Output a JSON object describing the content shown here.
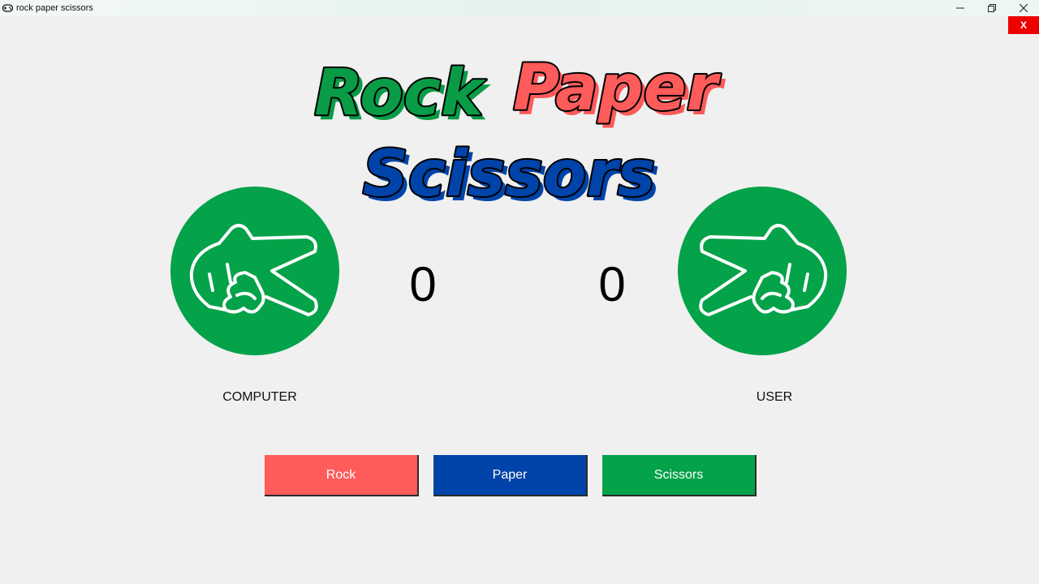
{
  "window": {
    "title": "rock paper scissors",
    "icon": "gamepad-icon",
    "close_button": "X"
  },
  "logo": {
    "line1_word1": "Rock",
    "line1_word2": "Paper",
    "line2": "Scissors",
    "colors": {
      "rock": "#0a9b47",
      "paper": "#fe5b5b",
      "scissors": "#0044a9"
    }
  },
  "computer": {
    "label": "COMPUTER",
    "score": "0",
    "hand": "scissors-hand-icon"
  },
  "user": {
    "label": "USER",
    "score": "0",
    "hand": "scissors-hand-icon"
  },
  "buttons": {
    "rock": "Rock",
    "paper": "Paper",
    "scissors": "Scissors"
  },
  "colors": {
    "rock": "#fe5b5b",
    "paper": "#0044a9",
    "scissors": "#04a249",
    "close": "#ee0000",
    "background": "#f0f0f0"
  }
}
